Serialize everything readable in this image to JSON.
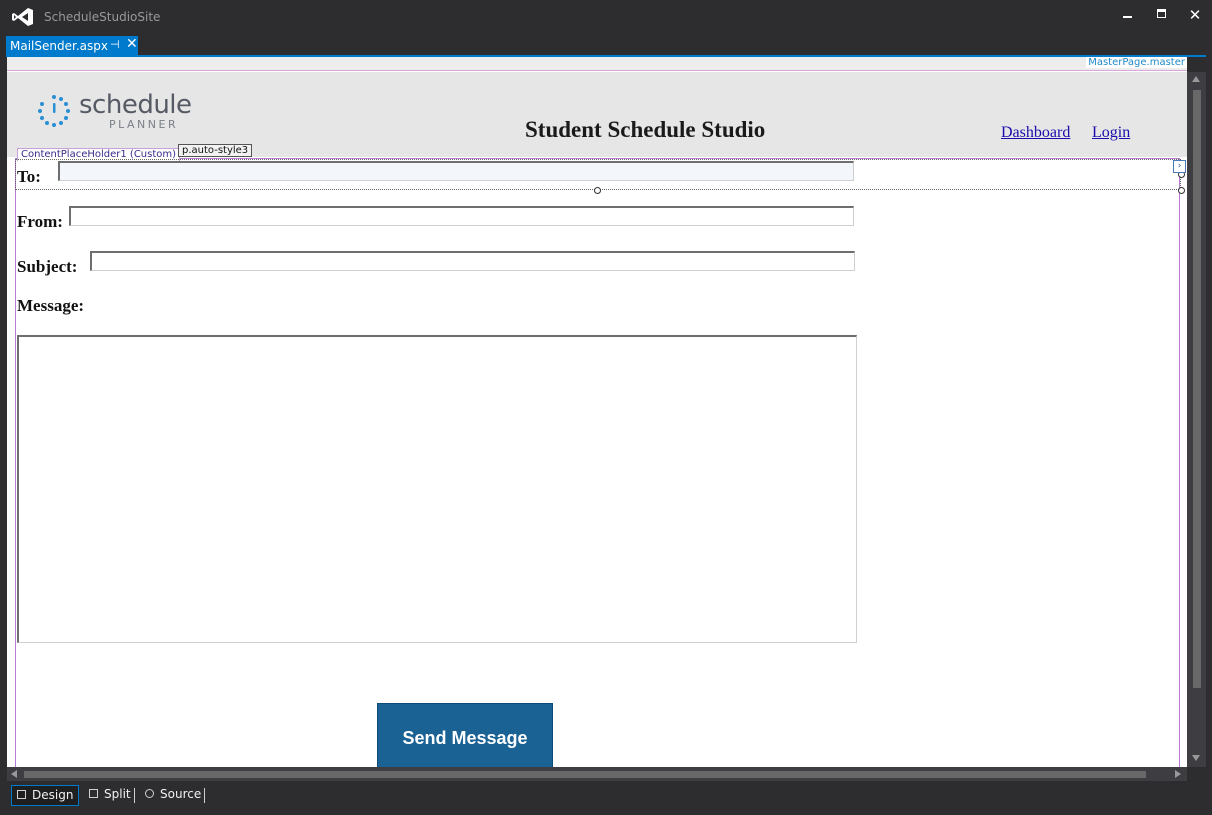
{
  "app": {
    "title": "ScheduleStudioSite"
  },
  "tabs": [
    {
      "label": "MailSender.aspx",
      "active": true
    }
  ],
  "designer": {
    "master_page_label": "MasterPage.master",
    "content_placeholder_tag": "ContentPlaceHolder1 (Custom)",
    "selected_element_tag": "p.auto-style3"
  },
  "header": {
    "logo_word": "schedule",
    "logo_sub": "PLANNER",
    "site_title": "Student Schedule Studio",
    "nav": [
      {
        "label": "Dashboard"
      },
      {
        "label": "Login"
      }
    ]
  },
  "form": {
    "to_label": "To:",
    "from_label": "From:",
    "subject_label": "Subject:",
    "message_label": "Message:",
    "to_value": "",
    "from_value": "",
    "subject_value": "",
    "message_value": "",
    "send_button": "Send Message"
  },
  "view_tabs": [
    {
      "label": "Design",
      "active": true
    },
    {
      "label": "Split",
      "active": false
    },
    {
      "label": "Source",
      "active": false
    }
  ],
  "colors": {
    "accent": "#007acc",
    "chrome": "#2d2d30",
    "send_button": "#1a6194",
    "logo_dots": "#2a8fd4"
  },
  "icons": [
    "visual-studio-icon",
    "minimize-icon",
    "maximize-icon",
    "close-icon",
    "pin-icon",
    "smart-tag-icon",
    "design-view-icon",
    "split-view-icon",
    "source-view-icon"
  ]
}
